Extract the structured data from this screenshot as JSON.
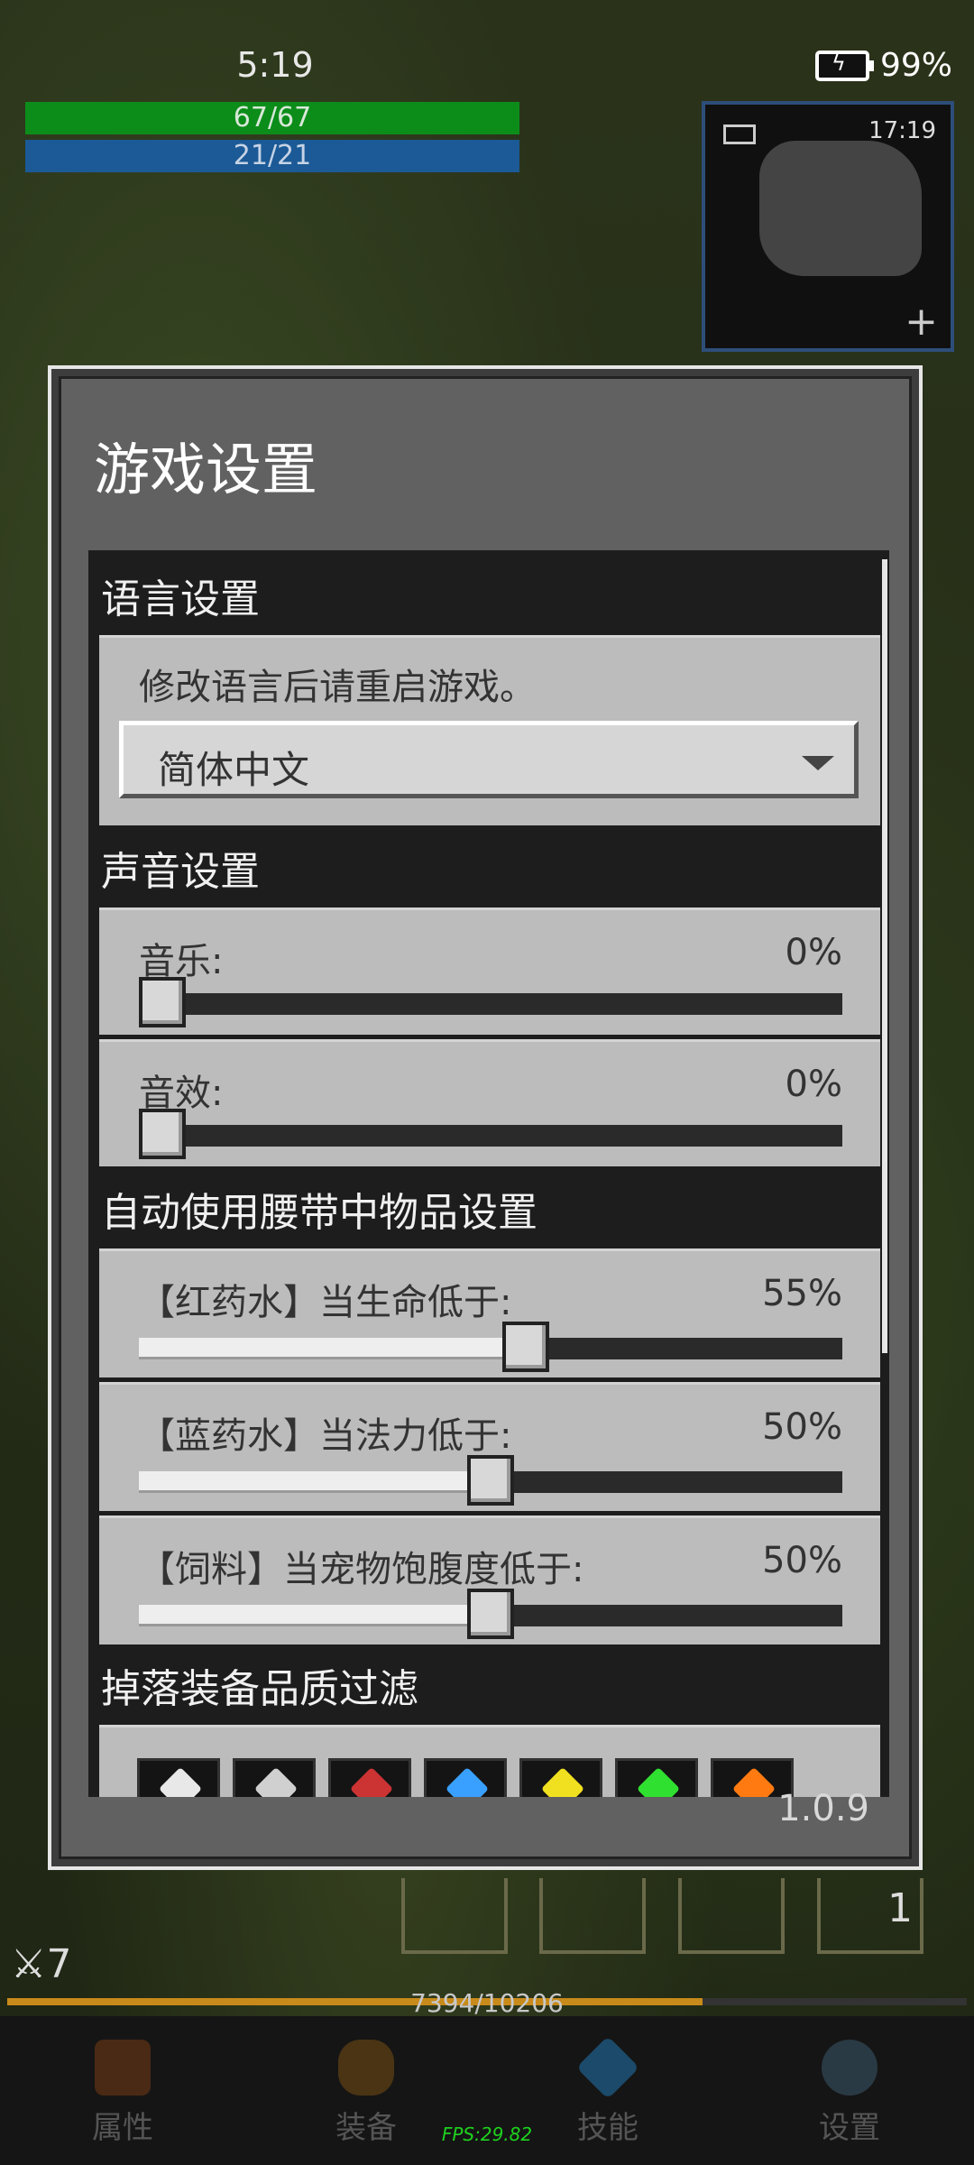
{
  "status_bar": {
    "time": "5:19",
    "battery": "99%"
  },
  "player": {
    "hp": "67/67",
    "mp": "21/21",
    "level": "7",
    "xp": "7394/10206",
    "xp_fraction": 0.7245
  },
  "minimap": {
    "time": "17:19",
    "zoom_label": "+"
  },
  "dialog": {
    "title": "游戏设置",
    "language": {
      "header": "语言设置",
      "note": "修改语言后请重启游戏。",
      "selected": "简体中文"
    },
    "sound": {
      "header": "声音设置",
      "music_label": "音乐:",
      "music_value": "0%",
      "music_level": 0.0,
      "sfx_label": "音效:",
      "sfx_value": "0%",
      "sfx_level": 0.0
    },
    "auto_use": {
      "header": "自动使用腰带中物品设置",
      "red_label": "【红药水】当生命低于:",
      "red_value": "55%",
      "red_level": 0.55,
      "blue_label": "【蓝药水】当法力低于:",
      "blue_value": "50%",
      "blue_level": 0.5,
      "feed_label": "【饲料】当宠物饱腹度低于:",
      "feed_value": "50%",
      "feed_level": 0.5
    },
    "drop_filter": {
      "header": "掉落装备品质过滤",
      "colors": [
        "#e8e8e8",
        "#d0d0d0",
        "#cc3333",
        "#3aa0ff",
        "#f0e020",
        "#30e030",
        "#ff7a10"
      ]
    },
    "version": "1.0.9"
  },
  "slot_number": "1",
  "nav": {
    "attributes": "属性",
    "equipment": "装备",
    "skills": "技能",
    "settings": "设置"
  },
  "fps": "FPS:29.82"
}
